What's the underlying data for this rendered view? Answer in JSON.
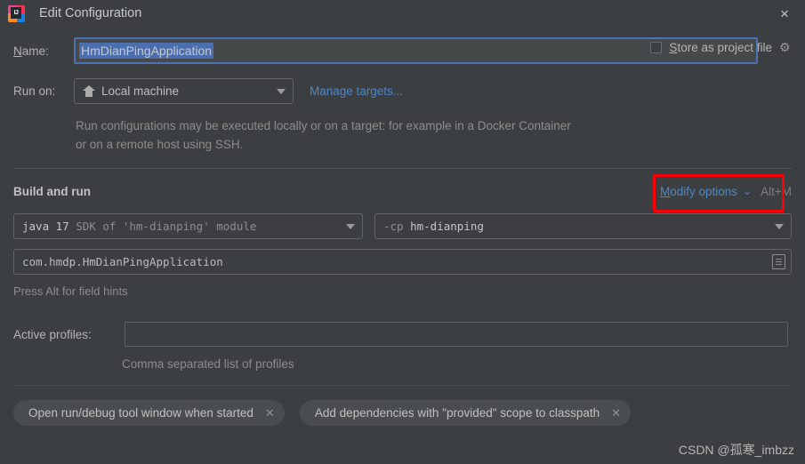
{
  "window": {
    "title": "Edit Configuration",
    "app_icon": "intellij-idea-icon",
    "close_icon": "×"
  },
  "name_row": {
    "label_pre": "N",
    "label_post": "ame:",
    "value": "HmDianPingApplication"
  },
  "store_as_project_file": {
    "label_pre": "S",
    "label_post": "tore as project file",
    "checked": false,
    "gear_icon": "gear-icon"
  },
  "run_on": {
    "label": "Run on:",
    "selected": "Local machine",
    "icon": "home-icon",
    "manage_targets_link": "Manage targets..."
  },
  "description": "Run configurations may be executed locally or on a target: for example in a Docker Container or on a remote host using SSH.",
  "build_and_run": {
    "section_title": "Build and run",
    "modify_options_pre": "M",
    "modify_options_post": "odify options",
    "chevron": "⌄",
    "shortcut": "Alt+M",
    "jdk": {
      "bright": "java 17",
      "dim": " SDK of 'hm-dianping' module"
    },
    "classpath": {
      "dim": "-cp",
      "bright": " hm-dianping"
    },
    "main_class": "com.hmdp.HmDianPingApplication",
    "main_class_icon": "list-browse-icon",
    "field_hint": "Press Alt for field hints"
  },
  "active_profiles": {
    "label": "Active profiles:",
    "value": "",
    "hint": "Comma separated list of profiles"
  },
  "chips": [
    {
      "label": "Open run/debug tool window when started",
      "close": "✕"
    },
    {
      "label": "Add dependencies with \"provided\" scope to classpath",
      "close": "✕"
    }
  ],
  "watermark": "CSDN @孤寒_imbzz",
  "colors": {
    "background": "#3c3f41",
    "link": "#4e86c7",
    "annotation_red": "#fb0007",
    "selection_blue": "#4b6eaf",
    "focus_border": "#4a72b5"
  }
}
